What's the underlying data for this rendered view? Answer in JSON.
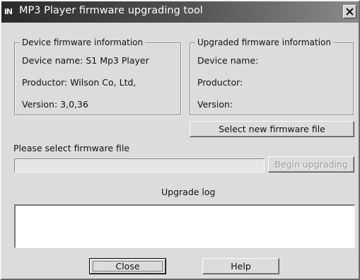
{
  "window": {
    "title": "MP3 Player firmware upgrading tool",
    "app_icon_glyph": "iN",
    "close_icon": "close-icon"
  },
  "device_group": {
    "legend": "Device firmware information",
    "device_name": "Device name: S1 Mp3 Player",
    "productor": "Productor: Wilson Co, Ltd,",
    "version": "Version: 3,0,36"
  },
  "upgraded_group": {
    "legend": "Upgraded firmware information",
    "device_name": "Device name:",
    "productor": "Productor:",
    "version": "Version:"
  },
  "select_file_button": "Select new firmware file",
  "file_prompt": "Please select firmware file",
  "file_path": {
    "value": "",
    "placeholder": ""
  },
  "begin_button": "Begin upgrading",
  "log": {
    "label": "Upgrade log",
    "content": ""
  },
  "close_button": "Close",
  "help_button": "Help",
  "colors": {
    "title_bar": "#2a2a2a",
    "dialog_bg": "#dcdcdc",
    "log_bg": "#ffffff"
  }
}
